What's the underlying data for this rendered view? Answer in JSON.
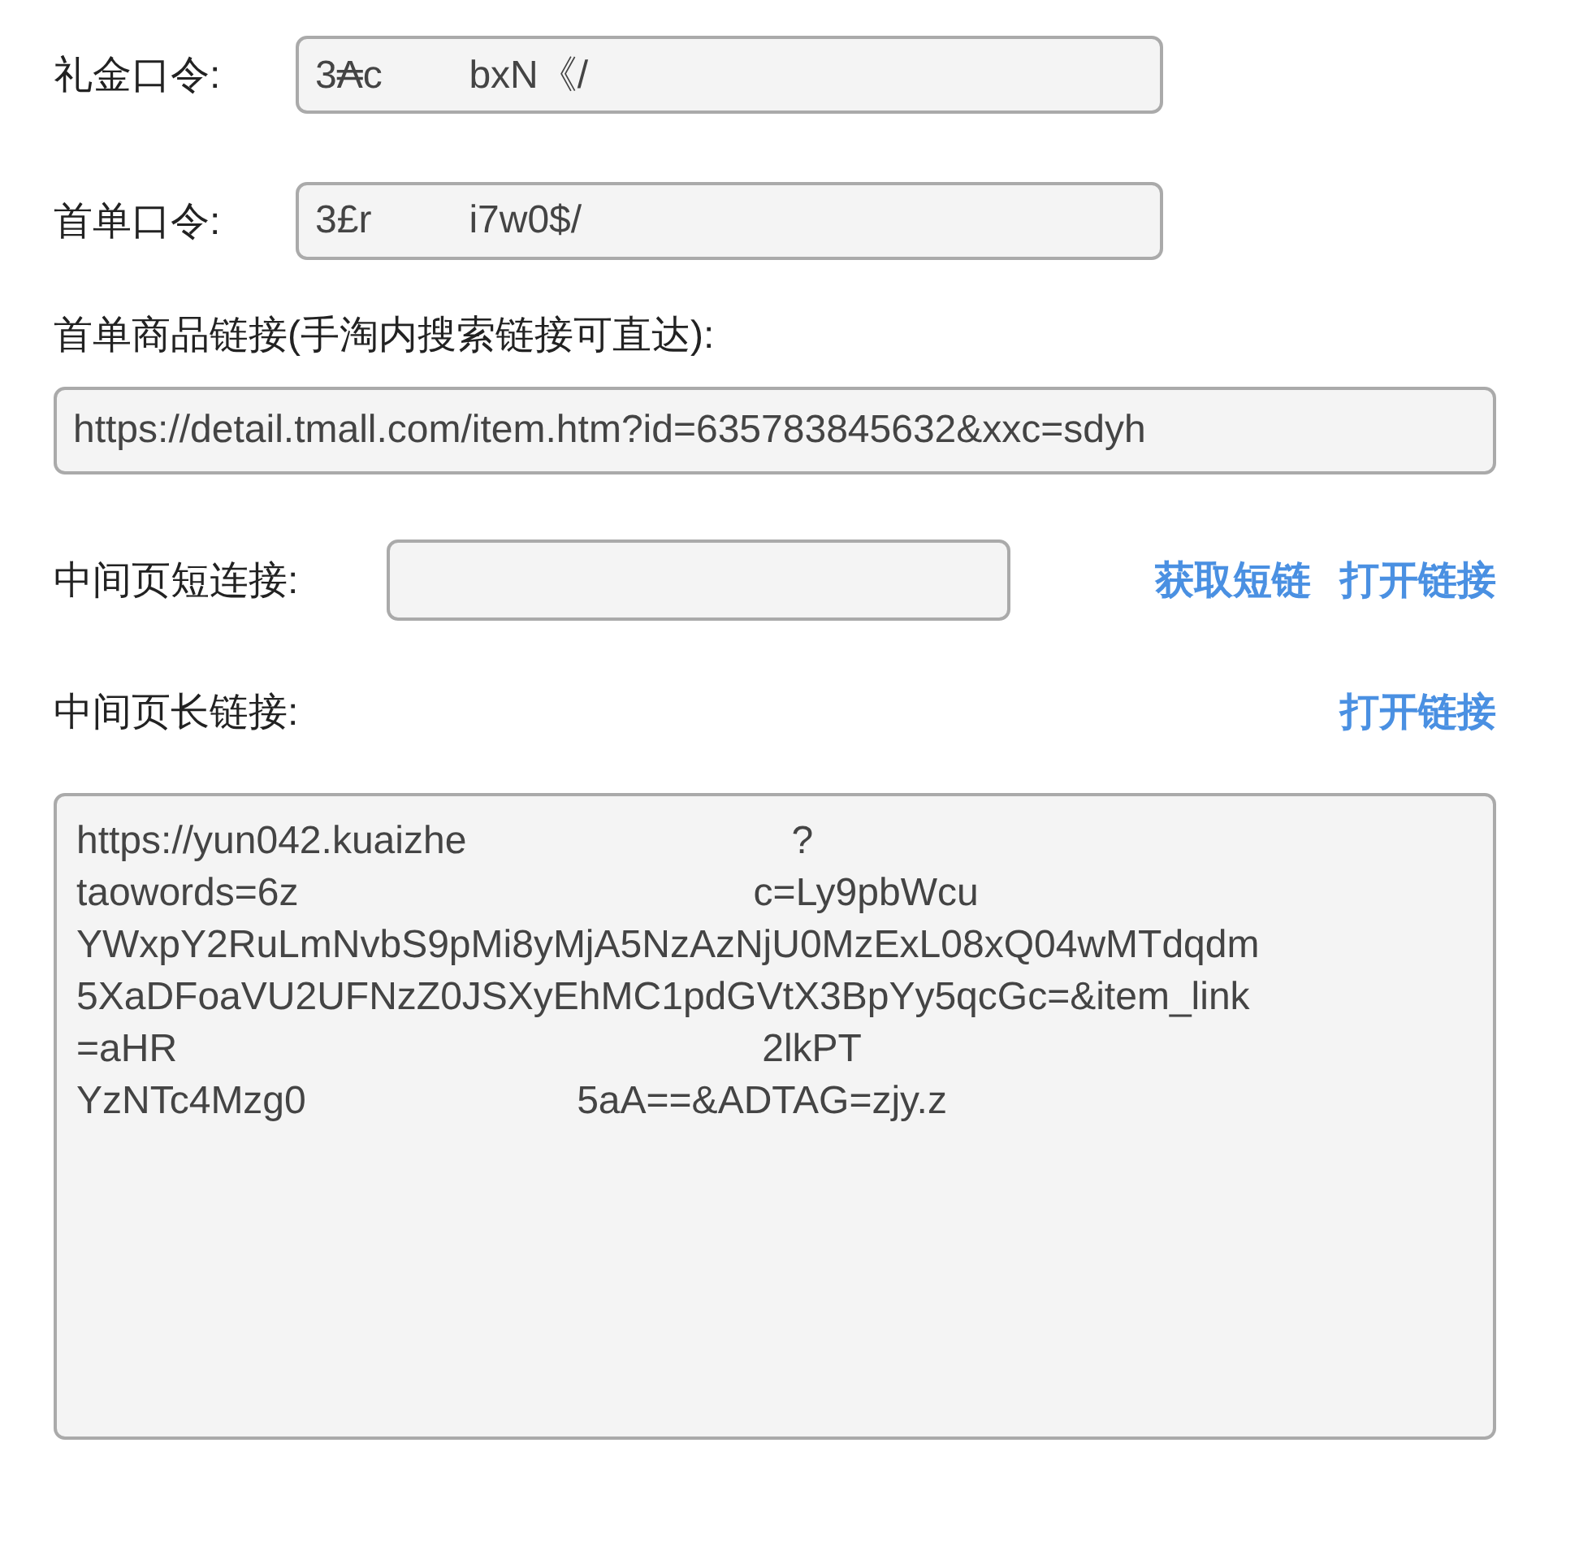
{
  "gift_code": {
    "label": "礼金口令:",
    "value": "3₳c        bxN《/"
  },
  "first_order_code": {
    "label": "首单口令:",
    "value": "3£r         i7w0$/"
  },
  "first_order_link": {
    "label": "首单商品链接(手淘内搜索链接可直达):",
    "value": "https://detail.tmall.com/item.htm?id=635783845632&xxc=sdyh"
  },
  "short_link": {
    "label": "中间页短连接:",
    "actions": [
      "获取短链",
      "打开链接"
    ]
  },
  "long_link": {
    "label": "中间页长链接:",
    "actions": [
      "打开链接"
    ],
    "value_lines": [
      "https://yun042.kuaizhe                              ?",
      "taowords=6z                                          c=Ly9pbWcu",
      "YWxpY2RuLmNvbS9pMi8yMjA5NzAzNjU0MzExL08xQ04wMTdqdm",
      "5XaDFoaVU2UFNzZ0JSXyEhMC1pdGVtX3BpYy5qcGc=&item_link",
      "=aHR                                                      2lkPT",
      "YzNTc4Mzg0                         5aA==&ADTAG=zjy.z"
    ]
  }
}
